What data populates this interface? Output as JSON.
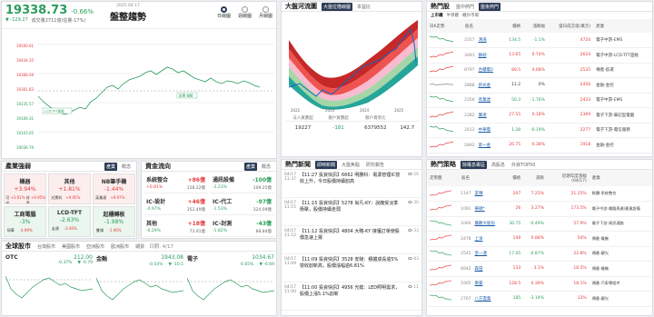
{
  "index": {
    "value": "19338.73",
    "pct": "-0.66%",
    "chg": "▼ -129.27",
    "vol": "成交量2711億(估量-17%)",
    "date": "2025.04.17",
    "status": "盤整趨勢",
    "periods": [
      "日線圖",
      "週線圖",
      "月線圖"
    ],
    "yticks": [
      "19500.61",
      "19434.35",
      "19368.09",
      "19301.83",
      "19235.57",
      "19169.31",
      "19103.05",
      "19036.79"
    ],
    "ma_label": "LCD-TFT面板",
    "annot": "區間 盤整"
  },
  "sectors": {
    "title": "產業強弱",
    "tabs": [
      "產業",
      "概念"
    ],
    "cards": [
      {
        "name": "機器",
        "pct": "+3.94%",
        "a": "可成",
        "b": "+3.61%",
        "c": "技嘉",
        "d": "+9.95%",
        "trend": "up"
      },
      {
        "name": "其他",
        "pct": "+1.81%",
        "a": "光寶科",
        "b": "+9.95%",
        "c": "",
        "d": "",
        "trend": "up"
      },
      {
        "name": "NB筆手機",
        "pct": "-1.44%",
        "a": "英業達",
        "b": "+9.97%",
        "c": "",
        "d": "",
        "trend": "up"
      },
      {
        "name": "工商電腦",
        "pct": "-3%",
        "a": "研華",
        "b": "-4.99%",
        "c": "",
        "d": "",
        "trend": "dn"
      },
      {
        "name": "LCD-TFT",
        "pct": "-2.63%",
        "a": "友達",
        "b": "-3.46%",
        "c": "",
        "d": "",
        "trend": "dn"
      },
      {
        "name": "起櫃轉板",
        "pct": "-1.98%",
        "a": "雙鴻",
        "b": "-1.96%",
        "c": "",
        "d": "",
        "trend": "dn"
      }
    ]
  },
  "funds": {
    "title": "資金流向",
    "tabs": [
      "產業",
      "概念"
    ],
    "cards": [
      {
        "name": "系統整合",
        "amt": "+86億",
        "p": "+0.81%",
        "v": "158.22億",
        "trend": "up"
      },
      {
        "name": "通訊設備",
        "amt": "-100億",
        "p": "-3.23%",
        "v": "109.25億",
        "trend": "dn"
      },
      {
        "name": "IC-設計",
        "amt": "+46億",
        "p": "-0.97%",
        "v": "352.49億",
        "trend": "up"
      },
      {
        "name": "IC-代工",
        "amt": "-97億",
        "p": "-1.53%",
        "v": "324.09億",
        "trend": "dn"
      },
      {
        "name": "其他",
        "amt": "+18億",
        "p": "-0.29%",
        "v": "73.91億",
        "trend": "up"
      },
      {
        "name": "IC-封測",
        "amt": "-43億",
        "p": "-1.82%",
        "v": "88.84億",
        "trend": "dn"
      }
    ]
  },
  "global": {
    "title": "全球股市",
    "tabs": [
      "台灣股市",
      "美國股市",
      "亞洲股市",
      "歐洲股市",
      "期貨"
    ],
    "date": "日期: 4/17",
    "markets": [
      {
        "name": "OTC",
        "val": "212.00",
        "chg": "-0.37%",
        "chg2": "▼ -0.79"
      },
      {
        "name": "金融",
        "val": "1943.08",
        "chg": "-0.54%",
        "chg2": "▼ -10.5"
      },
      {
        "name": "電子",
        "val": "1034.67",
        "chg": "-0.65%",
        "chg2": "▼ -6.69"
      }
    ]
  },
  "bigflow": {
    "title": "大盤河流圖",
    "tabs": [
      "大盤位階線圖",
      "本益比"
    ],
    "xticks": [
      "2022",
      "2023",
      "2024",
      "2025"
    ],
    "cols": [
      "法人買賣超",
      "散戶買賣超",
      "散戶資券比"
    ],
    "row": [
      "19227",
      "-181",
      "6379552",
      "142.7"
    ]
  },
  "news": {
    "title": "熱門新聞",
    "tabs": [
      "即時新聞",
      "大盤焦點",
      "研究報告"
    ],
    "items": [
      {
        "d": "04/17",
        "t": "11:37",
        "title": "【11:27 投資快訊】6662 明勝科：電源管理IC營收上升，今日股價持續創高",
        "n": "26"
      },
      {
        "d": "04/17",
        "t": "11:15",
        "title": "【11:15 投資快訊】5278 尚凡-KY：說廠受淡季衝擊，股價持續走弱",
        "n": "30"
      },
      {
        "d": "04/17",
        "t": "11:12",
        "title": "【11:12 投資快訊】4804 大略-KY 接獲訂單使股價急速上揚",
        "n": "33"
      },
      {
        "d": "04/17",
        "t": "11:09",
        "title": "【11:09 投資快訊】3528 安馳：積體成長逾5%營收創新高，股價漲幅逾6.81%",
        "n": "83"
      },
      {
        "d": "04/17",
        "t": "11:00",
        "title": "【11:00 投資快訊】4956 光鋐：LED照明需求，股價上漲5.1%創新",
        "n": "11"
      }
    ]
  },
  "hotstocks": {
    "title": "熱門股",
    "tabs": [
      "盤中熱門",
      "盤後熱門"
    ],
    "subtabs": [
      "上市櫃",
      "半導體",
      "櫃外市場"
    ],
    "cols": [
      "日K走勢",
      "股名",
      "價格",
      "漲跌幅",
      "當日成交值(萬元)",
      "產業"
    ],
    "rows": [
      {
        "code": "2317",
        "name": "鴻海",
        "price": "134.5",
        "chg": "-1.1%",
        "val": "4724",
        "ind": "電子中游-EMS",
        "tr": "dn"
      },
      {
        "code": "3481",
        "name": "群創",
        "price": "13.65",
        "chg": "0.74%",
        "val": "2624",
        "ind": "電子中游-LCD-TFT面板",
        "tr": "up"
      },
      {
        "code": "8797",
        "name": "台積電2",
        "price": "89.5",
        "chg": "4.68%",
        "val": "2535",
        "ind": "傳產-航運",
        "tr": "up"
      },
      {
        "code": "2888",
        "name": "新光金",
        "price": "11.2",
        "chg": "0%",
        "val": "2456",
        "ind": "金融-金控",
        "tr": "flat"
      },
      {
        "code": "2356",
        "name": "英業達",
        "price": "50.3",
        "chg": "-1.76%",
        "val": "2433",
        "ind": "電子中游-EMS",
        "tr": "dn"
      },
      {
        "code": "2382",
        "name": "廣達",
        "price": "27.55",
        "chg": "0.18%",
        "val": "2369",
        "ind": "電子下游-筆記型電腦",
        "tr": "up"
      },
      {
        "code": "2412",
        "name": "中華電",
        "price": "1.28",
        "chg": "-0.19%",
        "val": "2277",
        "ind": "電子下游-電信服務",
        "tr": "dn"
      },
      {
        "code": "2892",
        "name": "第一金",
        "price": "26.75",
        "chg": "0.38%",
        "val": "1918",
        "ind": "金融-金控",
        "tr": "up"
      }
    ]
  },
  "strategy": {
    "title": "熱門策略",
    "tabs": [
      "除權息專區",
      "高股息",
      "外資TOP50"
    ],
    "cols": [
      "走勢圖",
      "股名",
      "價格",
      "漲跌",
      "近期年度漲幅(04/17)",
      "產業"
    ],
    "rows": [
      {
        "code": "1147",
        "name": "友輝",
        "price": "207",
        "chg": "7.25%",
        "ytd": "21.25%",
        "ind": "軟體-系統整合",
        "tr": "up"
      },
      {
        "code": "1091",
        "name": "華碩*",
        "price": "26",
        "chg": "3.27%",
        "ytd": "173.5%",
        "ind": "電子中游-電腦周邊/產業設備",
        "tr": "up"
      },
      {
        "code": "1060",
        "name": "廣數大股份",
        "price": "30.75",
        "chg": "-0.49%",
        "ytd": "57.9%",
        "ind": "電子下游-資訊通路",
        "tr": "dn"
      },
      {
        "code": "2478",
        "name": "上洋",
        "price": "149",
        "chg": "0.88%",
        "ytd": "54%",
        "ind": "傳產-電機",
        "tr": "up"
      },
      {
        "code": "2545",
        "name": "皇一澳",
        "price": "17.05",
        "chg": "-0.87%",
        "ytd": "22.8%",
        "ind": "傳產-觀光",
        "tr": "dn"
      },
      {
        "code": "8942",
        "name": "森田",
        "price": "133",
        "chg": "3.1%",
        "ytd": "18.5%",
        "ind": "傳產-電機",
        "tr": "up"
      },
      {
        "code": "1905",
        "name": "東豪",
        "price": "128.5",
        "chg": "0.39%",
        "ytd": "18.1%",
        "ind": "傳產-汽車零組件",
        "tr": "up"
      },
      {
        "code": "2767",
        "name": "八方雲集",
        "price": "185",
        "chg": "-3.14%",
        "ytd": "13%",
        "ind": "傳產-觀光",
        "tr": "dn"
      }
    ]
  }
}
